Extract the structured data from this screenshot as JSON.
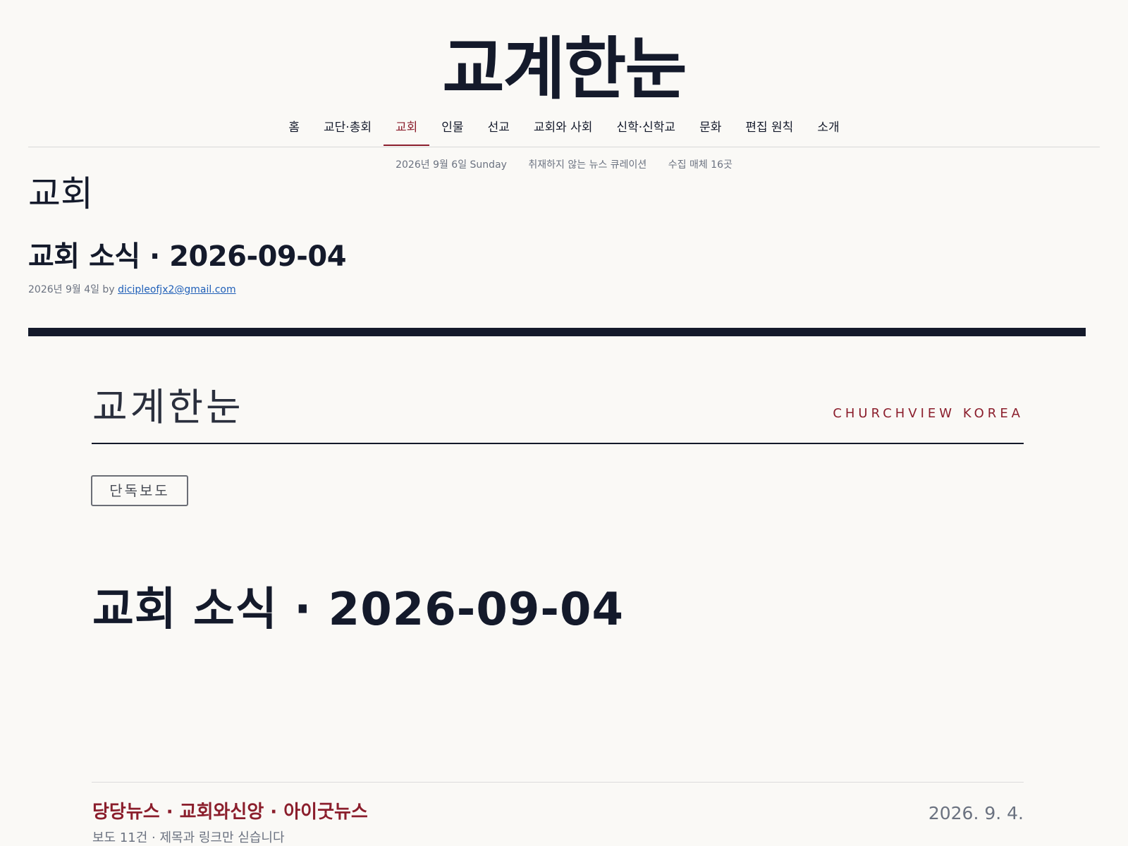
{
  "site": {
    "masthead": "교계한눈"
  },
  "nav": {
    "items": [
      {
        "label": "홈"
      },
      {
        "label": "교단·총회"
      },
      {
        "label": "교회"
      },
      {
        "label": "인물"
      },
      {
        "label": "선교"
      },
      {
        "label": "교회와 사회"
      },
      {
        "label": "신학·신학교"
      },
      {
        "label": "문화"
      },
      {
        "label": "편집 원칙"
      },
      {
        "label": "소개"
      }
    ],
    "active": "교회"
  },
  "subbar": {
    "date": "2026년 9월 6일 Sunday",
    "tagline": "취재하지 않는 뉴스 큐레이션",
    "sources_count": "수집 매체 16곳"
  },
  "category": {
    "title": "교회"
  },
  "post": {
    "title": "교회 소식 · 2026-09-04",
    "meta_prefix": "2026년 9월 4일 by",
    "author": "dicipleofjx2@gmail.com"
  },
  "card": {
    "logo": "교계한눈",
    "brand": "CHURCHVIEW KOREA",
    "badge": "단독보도",
    "title": "교회 소식 · 2026-09-04",
    "sources": "당당뉴스 · 교회와신앙 · 아이굿뉴스",
    "date": "2026. 9. 4.",
    "cutoff_text": "보도 11건 · 제목과 링크만 싣습니다"
  },
  "colors": {
    "accent": "#8b1e2c",
    "ink": "#141a2b",
    "link": "#1f5fb8",
    "background": "#faf9f6"
  }
}
